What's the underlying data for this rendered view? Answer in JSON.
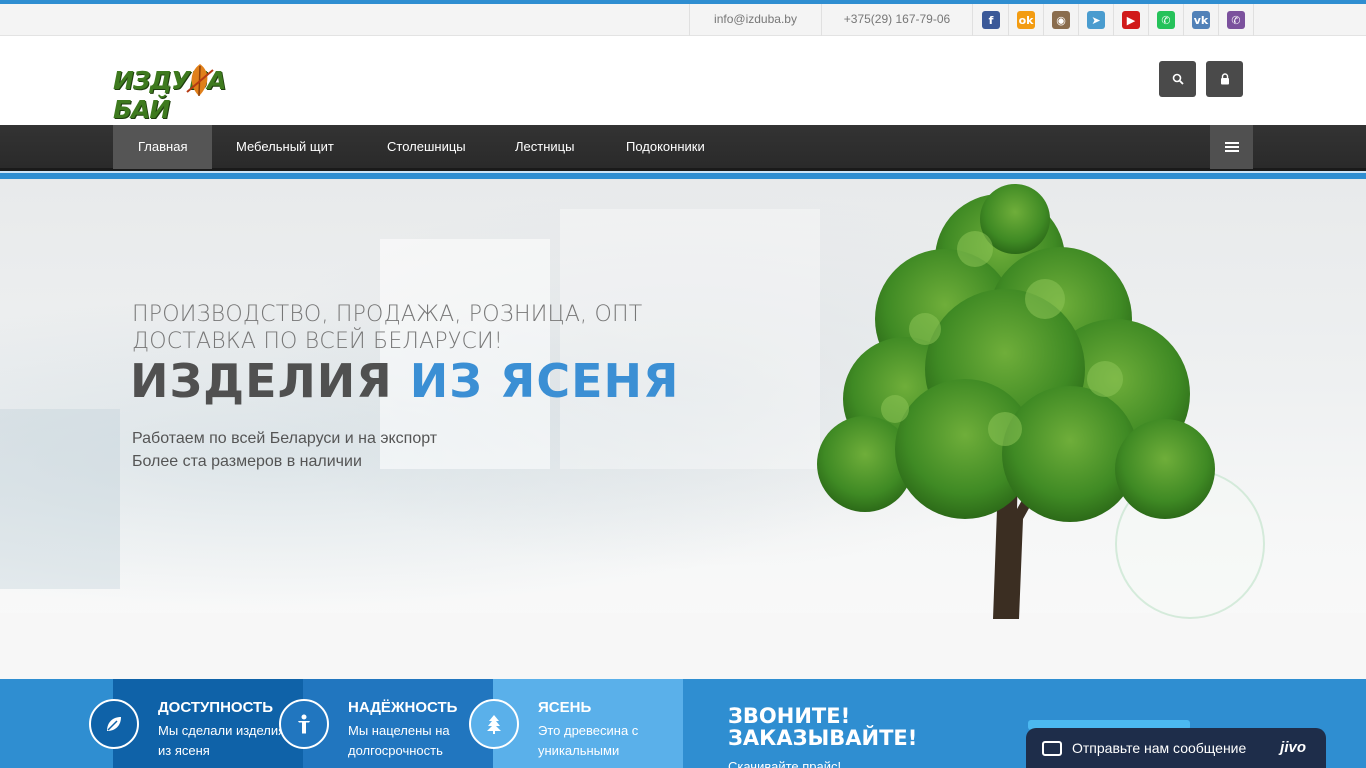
{
  "topbar": {
    "email": "info@izduba.by",
    "phone": "+375(29) 167-79-06",
    "socials": [
      {
        "name": "facebook-icon",
        "glyph": "f",
        "color": "#3b5998"
      },
      {
        "name": "odnoklassniki-icon",
        "glyph": "ok",
        "color": "#f39c12"
      },
      {
        "name": "instagram-icon",
        "glyph": "◉",
        "color": "#8a6d4e"
      },
      {
        "name": "telegram-icon",
        "glyph": "➤",
        "color": "#4a9ccf"
      },
      {
        "name": "youtube-icon",
        "glyph": "▶",
        "color": "#d11a1a"
      },
      {
        "name": "whatsapp-icon",
        "glyph": "✆",
        "color": "#25c25a"
      },
      {
        "name": "vk-icon",
        "glyph": "vk",
        "color": "#5181b8"
      },
      {
        "name": "viber-icon",
        "glyph": "✆",
        "color": "#7b519d"
      }
    ]
  },
  "logo": {
    "text": "ИЗДУБА БАЙ"
  },
  "nav": {
    "items": [
      {
        "label": "Главная",
        "active": true
      },
      {
        "label": "Мебельный щит",
        "active": false
      },
      {
        "label": "Столешницы",
        "active": false
      },
      {
        "label": "Лестницы",
        "active": false
      },
      {
        "label": "Подоконники",
        "active": false
      }
    ]
  },
  "hero": {
    "line1": "ПРОИЗВОДСТВО, ПРОДАЖА, РОЗНИЦА, ОПТ",
    "line2": "ДОСТАВКА ПО ВСЕЙ БЕЛАРУСИ!",
    "title_main": "ИЗДЕЛИЯ ",
    "title_accent": "ИЗ ЯСЕНЯ",
    "sub1": "Работаем по всей Беларуси и на экспорт",
    "sub2": "Более ста размеров в наличии"
  },
  "features": [
    {
      "title": "ДОСТУПНОСТЬ",
      "text": "Мы сделали изделия из ясеня"
    },
    {
      "title": "НАДЁЖНОСТЬ",
      "text": "Мы нацелены на долгосрочность"
    },
    {
      "title": "ЯСЕНЬ",
      "text": "Это древесина с уникальными"
    }
  ],
  "call": {
    "line1": "ЗВОНИТЕ!",
    "line2": "ЗАКАЗЫВАЙТЕ!",
    "sub": "Скачивайте прайс!"
  },
  "chat": {
    "label": "Отправьте нам сообщение",
    "brand": "jivo"
  },
  "colors": {
    "accent": "#2f8ed1",
    "title_accent": "#3b8fd4",
    "nav_bg": "#2f2f2f"
  }
}
